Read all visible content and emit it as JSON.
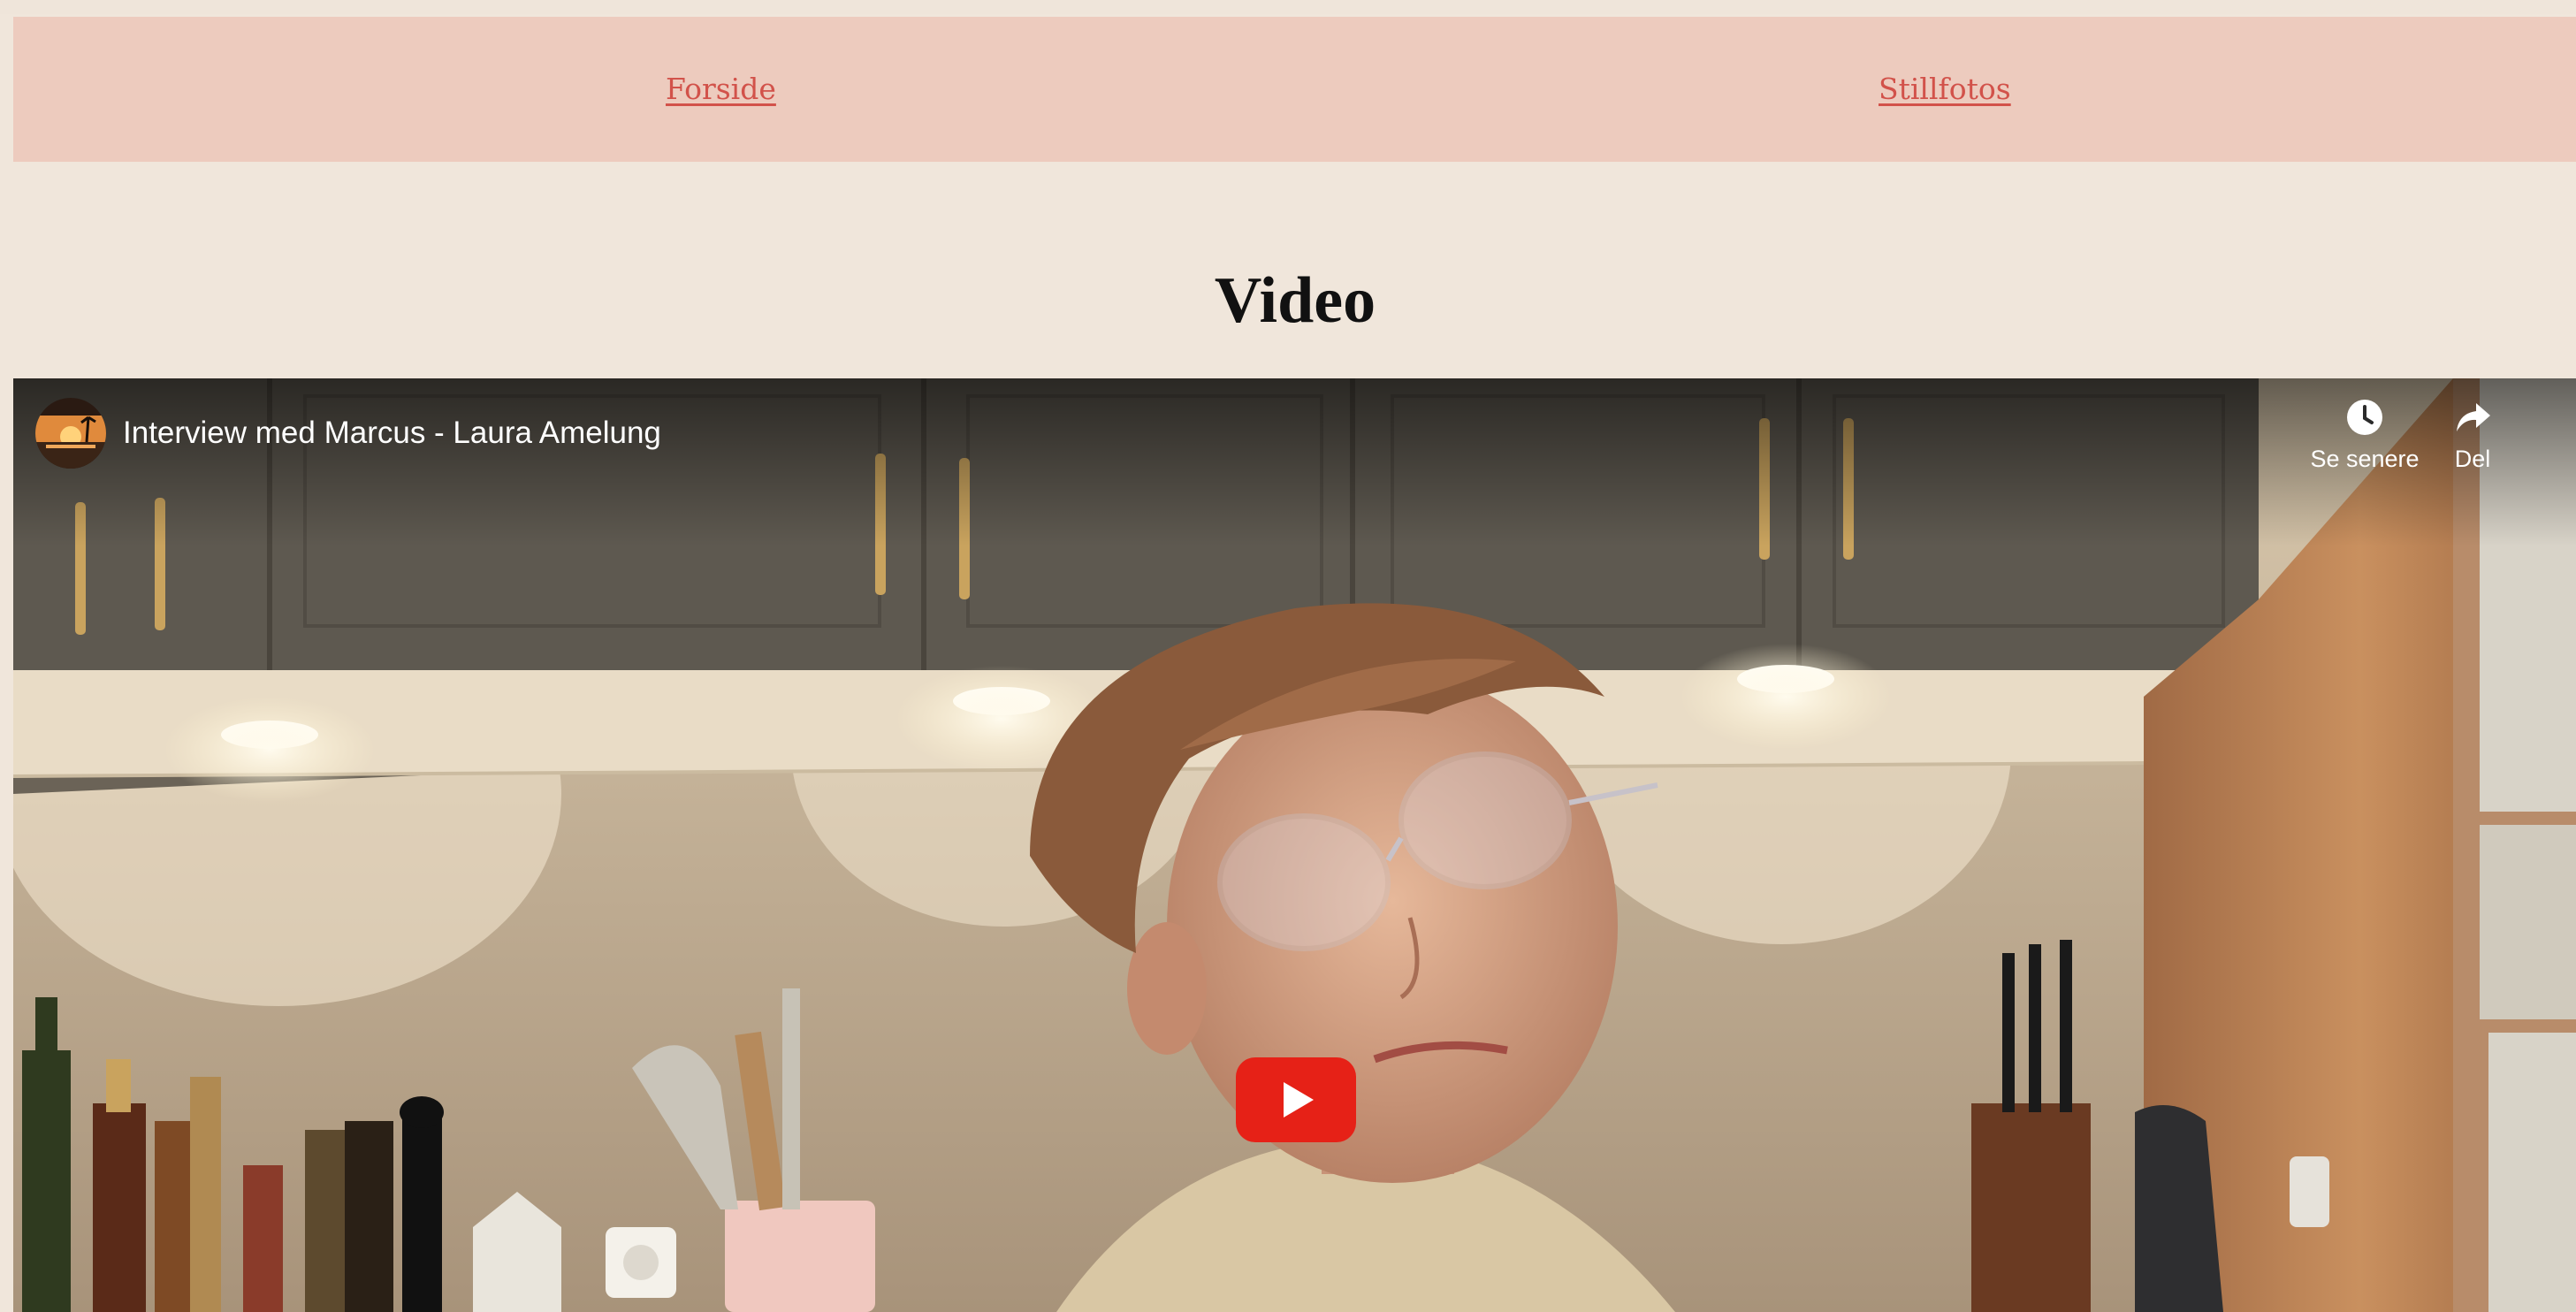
{
  "nav": {
    "links": [
      {
        "label": "Forside"
      },
      {
        "label": "Stillfotos"
      }
    ]
  },
  "page": {
    "title": "Video"
  },
  "video": {
    "title": "Interview med Marcus - Laura Amelung",
    "actions": {
      "watch_later": "Se senere",
      "share": "Del"
    },
    "play_icon": "youtube-play-icon",
    "colors": {
      "play_button": "#e62117",
      "nav_link": "#d2524a",
      "nav_background": "#edcbbe",
      "page_background": "#f0e6db"
    }
  }
}
